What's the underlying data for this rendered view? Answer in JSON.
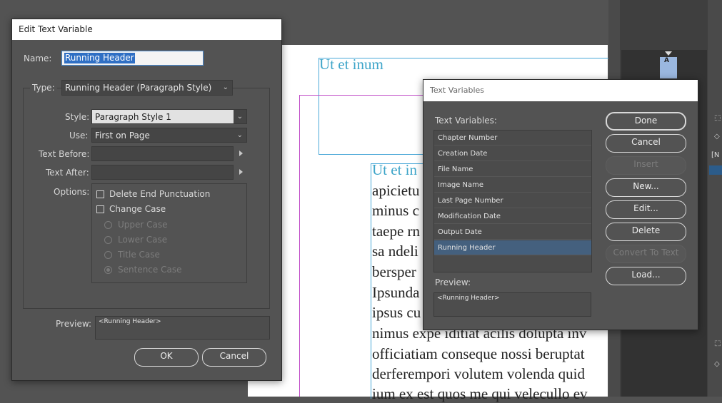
{
  "background": {
    "header_text": "Ut et inum",
    "body_lines": [
      "Ut et in",
      "apicietu",
      "minus c",
      "taepe rn",
      "sa ndeli",
      "bersper",
      "Ipsunda",
      "ipsus cu",
      "nimus expe iditiat acilis dolupta inv",
      "officiatiam conseque nossi beruptat",
      "derferempori volutem volenda quid",
      "ium ex est quos me qui velecullo ev"
    ],
    "page_thumb_letter": "A",
    "panel_label": "[N"
  },
  "edit_dialog": {
    "title": "Edit Text Variable",
    "name_label": "Name:",
    "name_value": "Running Header",
    "type_label": "Type:",
    "type_value": "Running Header (Paragraph Style)",
    "style_label": "Style:",
    "style_value": "Paragraph Style 1",
    "use_label": "Use:",
    "use_value": "First on Page",
    "text_before_label": "Text Before:",
    "text_after_label": "Text After:",
    "options_label": "Options:",
    "delete_end_punct": "Delete End Punctuation",
    "change_case": "Change Case",
    "upper_case": "Upper Case",
    "lower_case": "Lower Case",
    "title_case": "Title Case",
    "sentence_case": "Sentence Case",
    "preview_label": "Preview:",
    "preview_value": "<Running Header>",
    "ok": "OK",
    "cancel": "Cancel"
  },
  "tv_dialog": {
    "title": "Text Variables",
    "list_label": "Text Variables:",
    "items": [
      "Chapter Number",
      "Creation Date",
      "File Name",
      "Image Name",
      "Last Page Number",
      "Modification Date",
      "Output Date",
      "Running Header"
    ],
    "selected_index": 7,
    "preview_label": "Preview:",
    "preview_value": "<Running Header>",
    "buttons": {
      "done": "Done",
      "cancel": "Cancel",
      "insert": "Insert",
      "new": "New...",
      "edit": "Edit...",
      "delete": "Delete",
      "convert": "Convert To Text",
      "load": "Load..."
    }
  }
}
